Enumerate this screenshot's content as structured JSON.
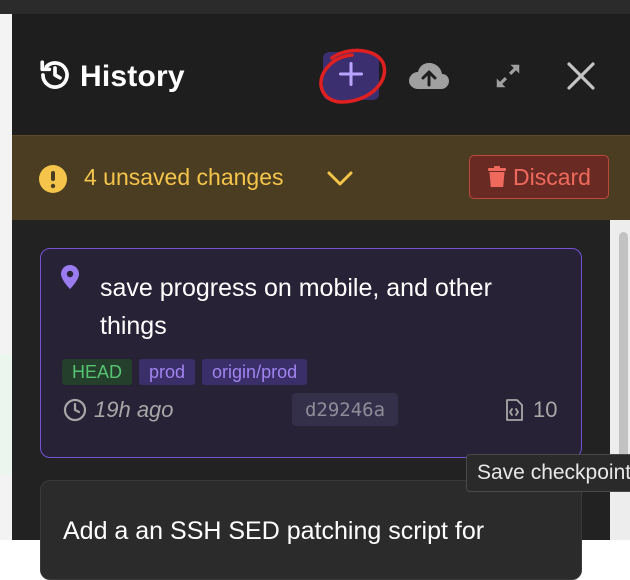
{
  "header": {
    "title": "History",
    "icons": {
      "history": "history-icon",
      "add": "plus-icon",
      "cloud": "cloud-upload-icon",
      "expand": "expand-icon",
      "close": "close-icon"
    },
    "add_button_color": "#3b2f70",
    "annotation_color": "#e02020"
  },
  "alert": {
    "text": "4 unsaved changes",
    "discard_label": "Discard",
    "color": "#f5c44a",
    "discard_color": "#ef6a5d"
  },
  "commits": [
    {
      "title": "save progress on mobile, and other things",
      "tags": [
        "HEAD",
        "prod",
        "origin/prod"
      ],
      "time": "19h ago",
      "hash": "d29246a",
      "files": "10"
    },
    {
      "title": "Add a an SSH SED patching script for"
    }
  ],
  "tooltip": {
    "text": "Save checkpoint"
  }
}
